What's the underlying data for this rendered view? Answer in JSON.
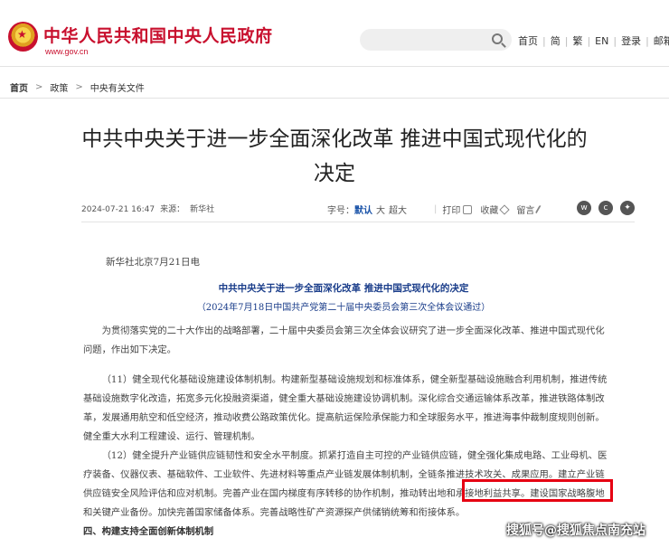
{
  "header": {
    "site_title": "中华人民共和国中央人民政府",
    "site_url": "www.gov.cn",
    "links": [
      "首页",
      "简",
      "繁",
      "EN",
      "登录",
      "邮箱"
    ]
  },
  "breadcrumb": [
    "首页",
    "政策",
    "中央有关文件"
  ],
  "article": {
    "title_line1": "中共中央关于进一步全面深化改革  推进中国式现代化的",
    "title_line2": "决定",
    "date": "2024-07-21 16:47",
    "source_label": "来源：",
    "source": "新华社",
    "fontsize_label": "字号：",
    "fontsize_default": "默认",
    "fontsize_large": "大",
    "fontsize_xlarge": "超大",
    "print_label": "打印",
    "favorite_label": "收藏",
    "comment_label": "留言",
    "dateline": "新华社北京7月21日电",
    "doc_title": "中共中央关于进一步全面深化改革 推进中国式现代化的决定",
    "doc_subtitle": "（2024年7月18日中国共产党第二十届中央委员会第三次全体会议通过）",
    "para1": "为贯彻落实党的二十大作出的战略部署，二十届中央委员会第三次全体会议研究了进一步全面深化改革、推进中国式现代化问题，作出如下决定。",
    "para2": "（11）健全现代化基础设施建设体制机制。构建新型基础设施规划和标准体系，健全新型基础设施融合利用机制，推进传统基础设施数字化改造，拓宽多元化投融资渠道，健全重大基础设施建设协调机制。深化综合交通运输体系改革，推进铁路体制改革，发展通用航空和低空经济，推动收费公路政策优化。提高航运保险承保能力和全球服务水平，推进海事仲裁制度规则创新。健全重大水利工程建设、运行、管理机制。",
    "para3": "（12）健全提升产业链供应链韧性和安全水平制度。抓紧打造自主可控的产业链供应链，健全强化集成电路、工业母机、医疗装备、仪器仪表、基础软件、工业软件、先进材料等重点产业链发展体制机制，全链条推进技术攻关、成果应用。建立产业链供应链安全风险评估和应对机制。完善产业在国内梯度有序转移的协作机制，推动转出地和承接地利益共享。建设国家战略腹地和关键产业备份。加快完善国家储备体系。完善战略性矿产资源探产供储销统筹和衔接体系。",
    "section_heading": "四、构建支持全面创新体制机制"
  },
  "watermark": "搜狐号@搜狐焦点南充站",
  "colors": {
    "brand_red": "#c8102e",
    "highlight": "#e60012",
    "doc_blue": "#1a3d8a"
  }
}
